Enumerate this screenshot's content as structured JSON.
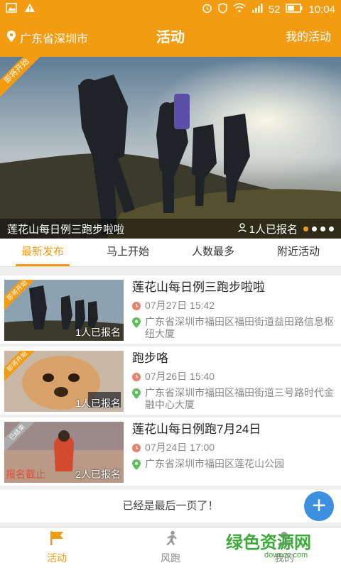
{
  "status_bar": {
    "battery": "52",
    "time": "10:04"
  },
  "header": {
    "location": "广东省深圳市",
    "title": "活动",
    "my_activities": "我的活动"
  },
  "banner": {
    "ribbon": "即将开始",
    "title": "莲花山每日例三跑步啦啦",
    "signup_count": "1人已报名",
    "slide_count": 4,
    "active_slide": 1
  },
  "tabs": [
    {
      "label": "最新发布",
      "active": true
    },
    {
      "label": "马上开始",
      "active": false
    },
    {
      "label": "人数最多",
      "active": false
    },
    {
      "label": "附近活动",
      "active": false
    }
  ],
  "activities": [
    {
      "ribbon": "即将开始",
      "signed": "1人已报名",
      "title": "莲花山每日例三跑步啦啦",
      "time": "07月27日 15:42",
      "address": "广东省深圳市福田区福田街道益田路信息枢纽大厦",
      "closed": ""
    },
    {
      "ribbon": "即将开始",
      "signed": "1人已报名",
      "title": "跑步咯",
      "time": "07月26日 15:40",
      "address": "广东省深圳市福田区福田街道三号路时代金融中心大厦",
      "closed": ""
    },
    {
      "ribbon": "已结束",
      "signed": "2人已报名",
      "title": "莲花山每日例跑7月24日",
      "time": "07月24日 17:00",
      "address": "广东省深圳市福田区莲花山公园",
      "closed": "报名截止"
    }
  ],
  "footer_note": "已经是最后一页了！",
  "fab": "+",
  "bottom_nav": [
    {
      "label": "活动",
      "icon": "flag-icon",
      "active": true
    },
    {
      "label": "风跑",
      "icon": "runner-icon",
      "active": false
    },
    {
      "label": "我的",
      "icon": "person-icon",
      "active": false
    }
  ],
  "watermark": {
    "text": "绿色资源网",
    "sub": "downcc.com"
  },
  "colors": {
    "accent": "#f39c12",
    "fab": "#3d8fe0",
    "time_icon": "#e8826b",
    "location_icon": "#5cc05c"
  }
}
